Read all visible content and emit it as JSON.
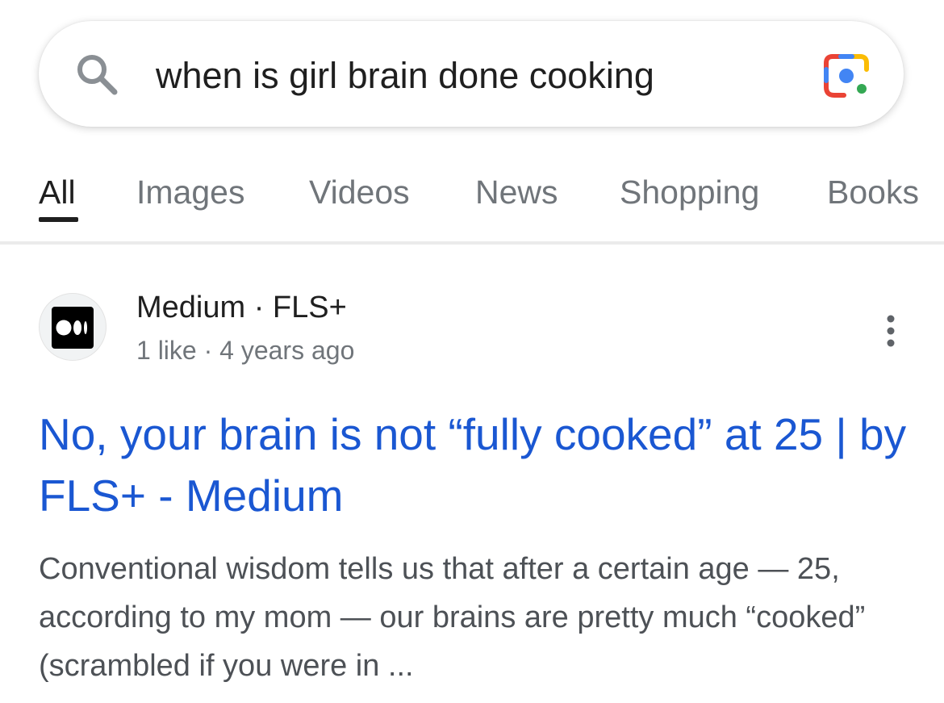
{
  "search": {
    "query": "when is girl brain done cooking"
  },
  "tabs": [
    {
      "label": "All",
      "active": true
    },
    {
      "label": "Images",
      "active": false
    },
    {
      "label": "Videos",
      "active": false
    },
    {
      "label": "News",
      "active": false
    },
    {
      "label": "Shopping",
      "active": false
    },
    {
      "label": "Books",
      "active": false
    }
  ],
  "result": {
    "source": "Medium · FLS+",
    "meta": "1 like · 4 years ago",
    "title": "No, your brain is not “fully cooked” at 25 | by FLS+ - Medium",
    "snippet": "Conventional wisdom tells us that after a certain age — 25, according to my mom — our brains are pretty much “cooked” (scrambled if you were in ..."
  },
  "colors": {
    "link": "#1a57d2",
    "text": "#1f1f1f",
    "muted": "#70757a",
    "snippet": "#4d5156"
  }
}
